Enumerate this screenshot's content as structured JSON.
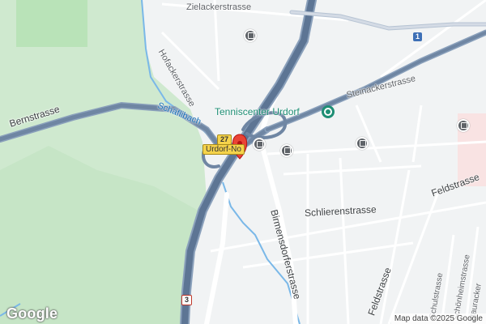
{
  "streets": {
    "zielackerstrasse": "Zielackerstrasse",
    "hofackerstrasse": "Hofackerstrasse",
    "bernstrasse": "Bernstrasse",
    "steinackerstrasse": "Steinackerstrasse",
    "schlierenstrasse": "Schlierenstrasse",
    "feldstrasse_top": "Feldstrasse",
    "feldstrasse_bottom": "Feldstrasse",
    "birmensdorferstrasse": "Birmensdorferstrasse",
    "schulstrasse": "Schulstrasse",
    "schoenheimstrasse": "Schönheimstrasse",
    "steinauracker": "Stauracker"
  },
  "water": {
    "schaeflibach": "Schäflibach"
  },
  "pois": {
    "tenniscenter": "Tenniscenter Urdorf"
  },
  "place_label": "Urdorf-No",
  "shields": {
    "route_27": "27",
    "route_1": "1",
    "route_3": "3"
  },
  "icons": [
    "tram-stop-icon",
    "location-pin-icon",
    "poi-marker-icon"
  ],
  "colors": {
    "background": "#f1f3f4",
    "forest": "#cfe9cf",
    "park": "#b9e3b8",
    "motorway": "#6f86a3",
    "main_road": "#ffffff",
    "water": "#7ab8e8",
    "pin": "#ea4335",
    "poi": "#1e8e74"
  },
  "branding": {
    "logo": "Google",
    "attribution": "Map data ©2025 Google"
  }
}
